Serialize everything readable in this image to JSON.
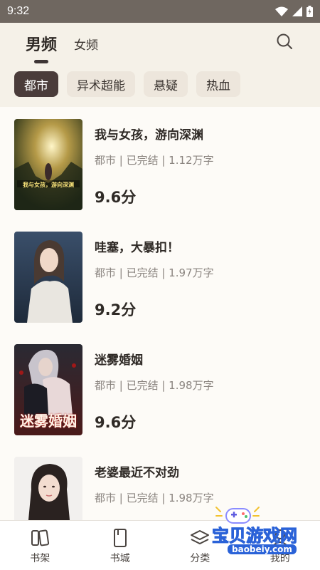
{
  "status_bar": {
    "time": "9:32"
  },
  "header": {
    "tab_male": "男频",
    "tab_female": "女频"
  },
  "chips": [
    "都市",
    "异术超能",
    "悬疑",
    "热血"
  ],
  "books": [
    {
      "title": "我与女孩，游向深渊",
      "meta": "都市 | 已完结 | 1.12万字",
      "score": "9.6分",
      "cover_text": "我与女孩，游向深渊"
    },
    {
      "title": "哇塞，大暴扣！",
      "meta": "都市 | 已完结 | 1.97万字",
      "score": "9.2分",
      "cover_text": ""
    },
    {
      "title": "迷雾婚姻",
      "meta": "都市 | 已完结 | 1.98万字",
      "score": "9.6分",
      "cover_text": "迷雾婚姻"
    },
    {
      "title": "老婆最近不对劲",
      "meta": "都市 | 已完结 | 1.98万字",
      "score": "",
      "cover_text": ""
    }
  ],
  "bottom_nav": [
    {
      "label": "书架",
      "icon": "bookshelf-icon"
    },
    {
      "label": "书城",
      "icon": "bookstore-icon"
    },
    {
      "label": "分类",
      "icon": "category-icon"
    },
    {
      "label": "我的",
      "icon": "profile-icon"
    }
  ],
  "watermark": {
    "text": "宝贝游戏网",
    "url": "baobeiy.com"
  }
}
